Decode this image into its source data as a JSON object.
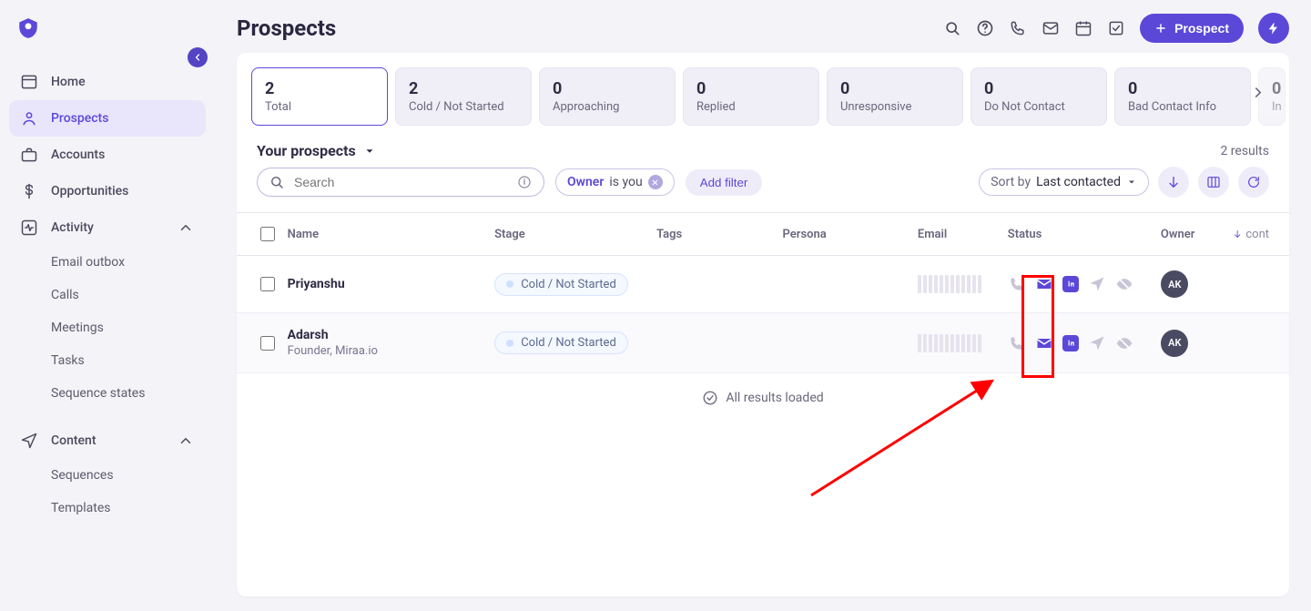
{
  "page_title": "Prospects",
  "header_actions": {
    "add_prospect_label": "Prospect"
  },
  "sidebar": {
    "items": [
      {
        "label": "Home"
      },
      {
        "label": "Prospects"
      },
      {
        "label": "Accounts"
      },
      {
        "label": "Opportunities"
      },
      {
        "label": "Activity"
      },
      {
        "label": "Content"
      }
    ],
    "activity_children": [
      "Email outbox",
      "Calls",
      "Meetings",
      "Tasks",
      "Sequence states"
    ],
    "content_children": [
      "Sequences",
      "Templates"
    ]
  },
  "tiles": [
    {
      "num": "2",
      "label": "Total"
    },
    {
      "num": "2",
      "label": "Cold / Not Started"
    },
    {
      "num": "0",
      "label": "Approaching"
    },
    {
      "num": "0",
      "label": "Replied"
    },
    {
      "num": "0",
      "label": "Unresponsive"
    },
    {
      "num": "0",
      "label": "Do Not Contact"
    },
    {
      "num": "0",
      "label": "Bad Contact Info"
    },
    {
      "num": "0",
      "label": "In"
    }
  ],
  "subhead": {
    "your_prospects": "Your prospects",
    "results_text": "2 results"
  },
  "search": {
    "placeholder": "Search"
  },
  "filter_chip": {
    "owner_label": "Owner",
    "is_you": "is you"
  },
  "add_filter_label": "Add filter",
  "sort": {
    "label": "Sort by",
    "value": "Last contacted"
  },
  "columns": {
    "name": "Name",
    "stage": "Stage",
    "tags": "Tags",
    "persona": "Persona",
    "email": "Email",
    "status": "Status",
    "owner": "Owner",
    "last": "cont"
  },
  "rows": [
    {
      "name": "Priyanshu",
      "subtitle": "",
      "stage": "Cold / Not Started",
      "owner_initials": "AK"
    },
    {
      "name": "Adarsh",
      "subtitle": "Founder, Miraa.io",
      "stage": "Cold / Not Started",
      "owner_initials": "AK"
    }
  ],
  "all_loaded": "All results loaded"
}
